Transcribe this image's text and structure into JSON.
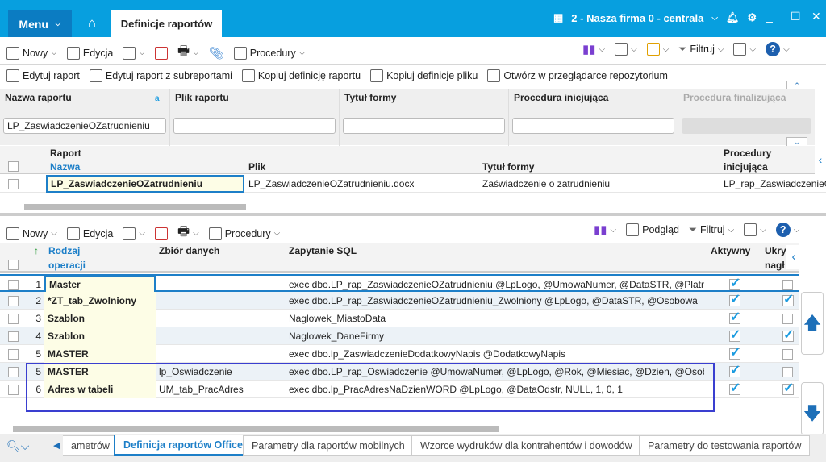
{
  "titlebar": {
    "menu": "Menu",
    "tab": "Definicje raportów",
    "company": "2 - Nasza firma 0 - centrala"
  },
  "toolbar1": {
    "new": "Nowy",
    "edit": "Edycja",
    "procedures": "Procedury",
    "filter": "Filtruj"
  },
  "toolbar2": {
    "items": [
      "Edytuj raport",
      "Edytuj raport z subreportami",
      "Kopiuj definicję raportu",
      "Kopiuj definicje pliku",
      "Otwórz w przeglądarce repozytorium"
    ]
  },
  "filters": [
    {
      "label": "Nazwa raportu",
      "value": "LP_ZaswiadczenieOZatrudnieniu"
    },
    {
      "label": "Plik raportu",
      "value": ""
    },
    {
      "label": "Tytuł formy",
      "value": ""
    },
    {
      "label": "Procedura inicjująca",
      "value": ""
    },
    {
      "label": "Procedura finalizująca",
      "value": ""
    }
  ],
  "grid1": {
    "group": "Raport",
    "group2": "Procedury",
    "columns": [
      "Nazwa",
      "Plik",
      "Tytuł formy",
      "inicjująca"
    ],
    "rows": [
      [
        "LP_ZaswiadczenieOZatrudnieniu",
        "LP_ZaswiadczenieOZatrudnieniu.docx",
        "Zaświadczenie o zatrudnieniu",
        "LP_rap_ZaswiadczenieO"
      ]
    ]
  },
  "toolbar3": {
    "new": "Nowy",
    "edit": "Edycja",
    "procedures": "Procedury",
    "preview": "Podgląd",
    "filter": "Filtruj"
  },
  "grid2": {
    "columns": {
      "type1": "Rodzaj",
      "type2": "operacji",
      "dataset": "Zbiór danych",
      "sql": "Zapytanie SQL",
      "active": "Aktywny",
      "hide1": "Ukryj",
      "hide2": "nagł"
    },
    "rows": [
      {
        "n": "1",
        "type": "Master",
        "dataset": "",
        "sql": "exec dbo.LP_rap_ZaswiadczenieOZatrudnieniu @LpLogo, @UmowaNumer, @DataSTR, @Platni",
        "active": true,
        "hide": false
      },
      {
        "n": "2",
        "type": "*ZT_tab_Zwolniony",
        "dataset": "",
        "sql": "exec dbo.LP_rap_ZaswiadczenieOZatrudnieniu_Zwolniony @LpLogo, @DataSTR, @Osobowa",
        "active": true,
        "hide": true
      },
      {
        "n": "3",
        "type": "Szablon",
        "dataset": "",
        "sql": "Naglowek_MiastoData",
        "active": true,
        "hide": false
      },
      {
        "n": "4",
        "type": "Szablon",
        "dataset": "",
        "sql": "Naglowek_DaneFirmy",
        "active": true,
        "hide": true
      },
      {
        "n": "5",
        "type": "MASTER",
        "dataset": "",
        "sql": "exec dbo.lp_ZaswiadczenieDodatkowyNapis @DodatkowyNapis",
        "active": true,
        "hide": false
      },
      {
        "n": "5",
        "type": "MASTER",
        "dataset": "lp_Oswiadczenie",
        "sql": "exec dbo.LP_rap_Oswiadczenie @UmowaNumer, @LpLogo, @Rok, @Miesiac, @Dzien, @Osoba",
        "active": true,
        "hide": false
      },
      {
        "n": "6",
        "type": "Adres w tabeli",
        "dataset": "UM_tab_PracAdres",
        "sql": "exec dbo.lp_PracAdresNaDzienWORD @LpLogo, @DataOdstr, NULL, 1, 0, 1",
        "active": true,
        "hide": true
      }
    ]
  },
  "bottom_tabs": [
    "ametrów",
    "Definicja raportów Office",
    "Parametry dla raportów mobilnych",
    "Wzorce wydruków dla kontrahentów i dowodów",
    "Parametry do testowania raportów"
  ],
  "colors": {
    "accent": "#079fdf",
    "highlight": "#3a3fd0"
  }
}
